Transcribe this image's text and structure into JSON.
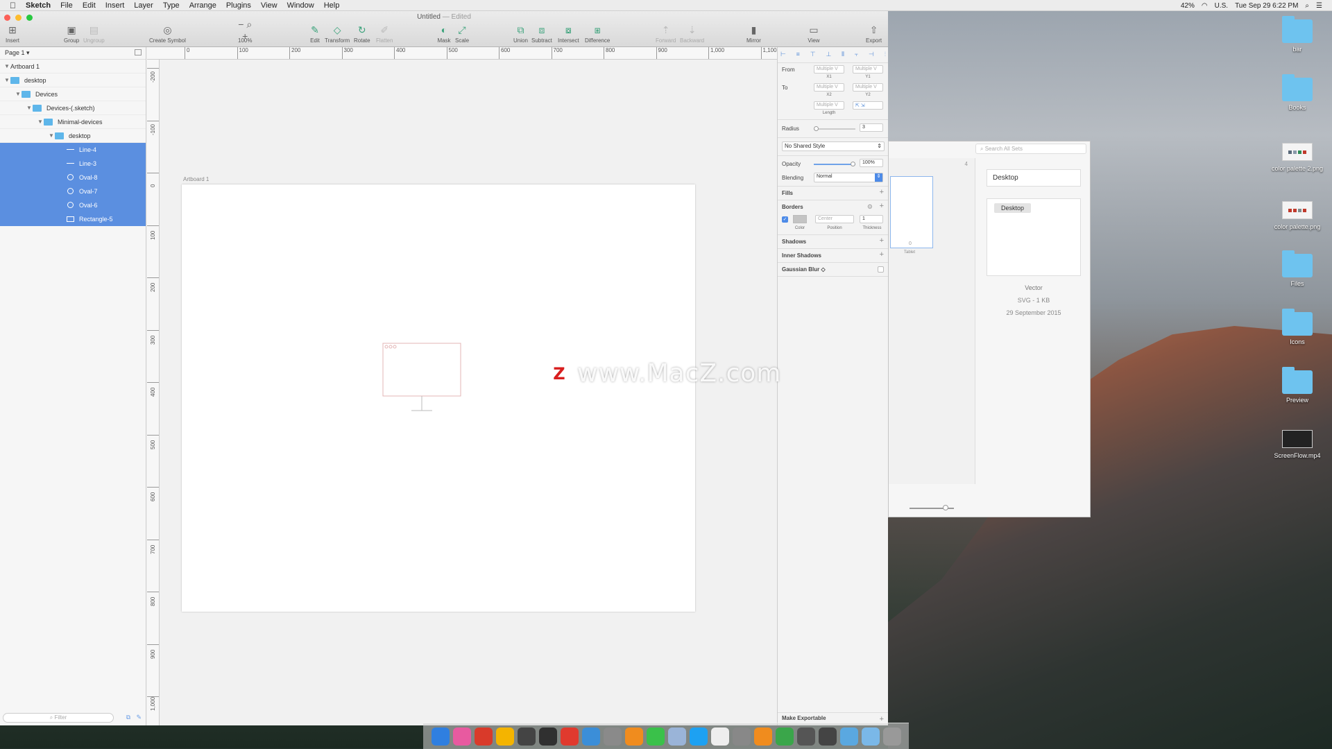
{
  "menubar": {
    "apple": "",
    "app": "Sketch",
    "items": [
      "File",
      "Edit",
      "Insert",
      "Layer",
      "Type",
      "Arrange",
      "Plugins",
      "View",
      "Window",
      "Help"
    ],
    "battery": "42%",
    "input": "U.S.",
    "clock": "Tue Sep 29  6:22 PM"
  },
  "document": {
    "title": "Untitled",
    "status": "— Edited"
  },
  "toolbar": {
    "insert": "Insert",
    "group": "Group",
    "ungroup": "Ungroup",
    "create_symbol": "Create Symbol",
    "zoom": "100%",
    "edit": "Edit",
    "transform": "Transform",
    "rotate": "Rotate",
    "flatten": "Flatten",
    "mask": "Mask",
    "scale": "Scale",
    "union": "Union",
    "subtract": "Subtract",
    "intersect": "Intersect",
    "difference": "Difference",
    "forward": "Forward",
    "backward": "Backward",
    "mirror": "Mirror",
    "view": "View",
    "export": "Export"
  },
  "layers": {
    "page": "Page 1 ▾",
    "rows": [
      {
        "label": "Artboard 1",
        "depth": 0,
        "kind": "artboard",
        "selected": false
      },
      {
        "label": "desktop",
        "depth": 0,
        "kind": "folder",
        "selected": false
      },
      {
        "label": "Devices",
        "depth": 1,
        "kind": "folder",
        "selected": false
      },
      {
        "label": "Devices-(.sketch)",
        "depth": 2,
        "kind": "folder",
        "selected": false
      },
      {
        "label": "Minimal-devices",
        "depth": 3,
        "kind": "folder",
        "selected": false
      },
      {
        "label": "desktop",
        "depth": 4,
        "kind": "folder",
        "selected": false
      },
      {
        "label": "Line-4",
        "depth": 5,
        "kind": "line",
        "selected": true
      },
      {
        "label": "Line-3",
        "depth": 5,
        "kind": "line",
        "selected": true
      },
      {
        "label": "Oval-8",
        "depth": 5,
        "kind": "oval",
        "selected": true
      },
      {
        "label": "Oval-7",
        "depth": 5,
        "kind": "oval",
        "selected": true
      },
      {
        "label": "Oval-6",
        "depth": 5,
        "kind": "oval",
        "selected": true
      },
      {
        "label": "Rectangle-5",
        "depth": 5,
        "kind": "rect",
        "selected": true
      }
    ],
    "filter_placeholder": "Filter"
  },
  "rulers": {
    "h": [
      "0",
      "100",
      "200",
      "300",
      "400",
      "500",
      "600",
      "700",
      "800",
      "900",
      "1,000",
      "1,100"
    ],
    "v": [
      "-200",
      "-100",
      "0",
      "100",
      "200",
      "300",
      "400",
      "500",
      "600",
      "700",
      "800",
      "900",
      "1,000"
    ]
  },
  "canvas": {
    "artboard_label": "Artboard 1"
  },
  "inspector": {
    "from": "From",
    "to": "To",
    "multiple": "Multiple V",
    "x1": "X1",
    "y1": "Y1",
    "x2": "X2",
    "y2": "Y2",
    "length": "Length",
    "radius_label": "Radius",
    "radius_value": "3",
    "shared_style": "No Shared Style",
    "opacity_label": "Opacity",
    "opacity_value": "100%",
    "opacity_level": 1.0,
    "blending_label": "Blending",
    "blending_value": "Normal",
    "fills": "Fills",
    "borders": "Borders",
    "border_position": "Center",
    "border_thickness": "1",
    "color_label": "Color",
    "position_label": "Position",
    "thickness_label": "Thickness",
    "shadows": "Shadows",
    "inner_shadows": "Inner Shadows",
    "gaussian_blur": "Gaussian Blur ◇",
    "make_exportable": "Make Exportable"
  },
  "library": {
    "search_placeholder": "Search All Sets",
    "count": "4",
    "tablet_label": "Tablet",
    "tablet_num": "0",
    "title": "Desktop",
    "preview_tag": "Desktop",
    "type": "Vector",
    "size": "SVG - 1 KB",
    "date": "29 September 2015"
  },
  "desktop_icons": [
    {
      "label": "bar",
      "kind": "folder"
    },
    {
      "label": "Books",
      "kind": "folder"
    },
    {
      "label": "color palette 2.png",
      "kind": "image"
    },
    {
      "label": "color palette.png",
      "kind": "image2"
    },
    {
      "label": "Files",
      "kind": "folder"
    },
    {
      "label": "Icons",
      "kind": "folder"
    },
    {
      "label": "Preview",
      "kind": "folder"
    },
    {
      "label": "ScreenFlow.mp4",
      "kind": "video"
    }
  ],
  "dock_colors": [
    "#2f7fe0",
    "#e85aa0",
    "#d93a2a",
    "#f4b400",
    "#444444",
    "#303030",
    "#e03a2e",
    "#3b8ed8",
    "#8a8a8a",
    "#f08c1e",
    "#3ac14a",
    "#9ab4d8",
    "#1da1f2",
    "#eeeeee",
    "#888888",
    "#f08c1e",
    "#3aa64a",
    "#555555",
    "#444444",
    "#5aa8e0",
    "#7ab8e8",
    "#999999"
  ],
  "watermark": {
    "logo": "Z",
    "text": "www.MacZ.com"
  }
}
